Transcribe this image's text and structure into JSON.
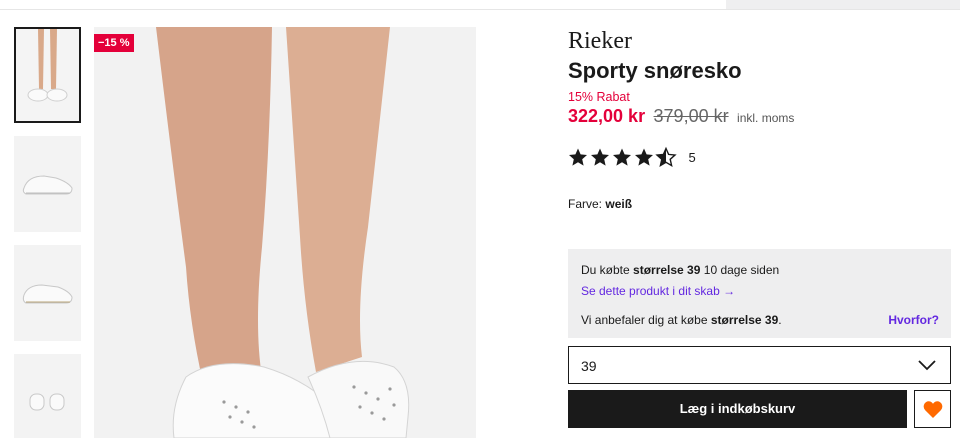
{
  "product": {
    "brand": "Rieker",
    "name": "Sporty snøresko",
    "discount_label": "15% Rabat",
    "badge": "−15 %",
    "price_new": "322,00 kr",
    "price_old": "379,00 kr",
    "vat_note": "inkl. moms",
    "rating_value": 4.5,
    "rating_count": "5",
    "color_label": "Farve:",
    "color_value": "weiß"
  },
  "size_info": {
    "bought_prefix": "Du købte",
    "bought_size": "størrelse 39",
    "bought_suffix": "10 dage siden",
    "wardrobe_link": "Se dette produkt i dit skab →",
    "recommend_prefix": "Vi anbefaler dig at købe",
    "recommend_size": "størrelse 39",
    "recommend_suffix": ".",
    "why_link": "Hvorfor?"
  },
  "size_select": {
    "value": "39"
  },
  "actions": {
    "add_to_cart": "Læg i indkøbskurv"
  },
  "colors": {
    "sale": "#e4003a",
    "link": "#6328e0",
    "wishlist": "#ff6900",
    "button": "#1a1a1a"
  },
  "gallery": {
    "thumbnails": [
      {
        "icon": "legs-sneakers-photo"
      },
      {
        "icon": "sneaker-side-photo"
      },
      {
        "icon": "sneaker-side-photo"
      },
      {
        "icon": "sneaker-heels-photo"
      }
    ],
    "active_index": 0
  }
}
